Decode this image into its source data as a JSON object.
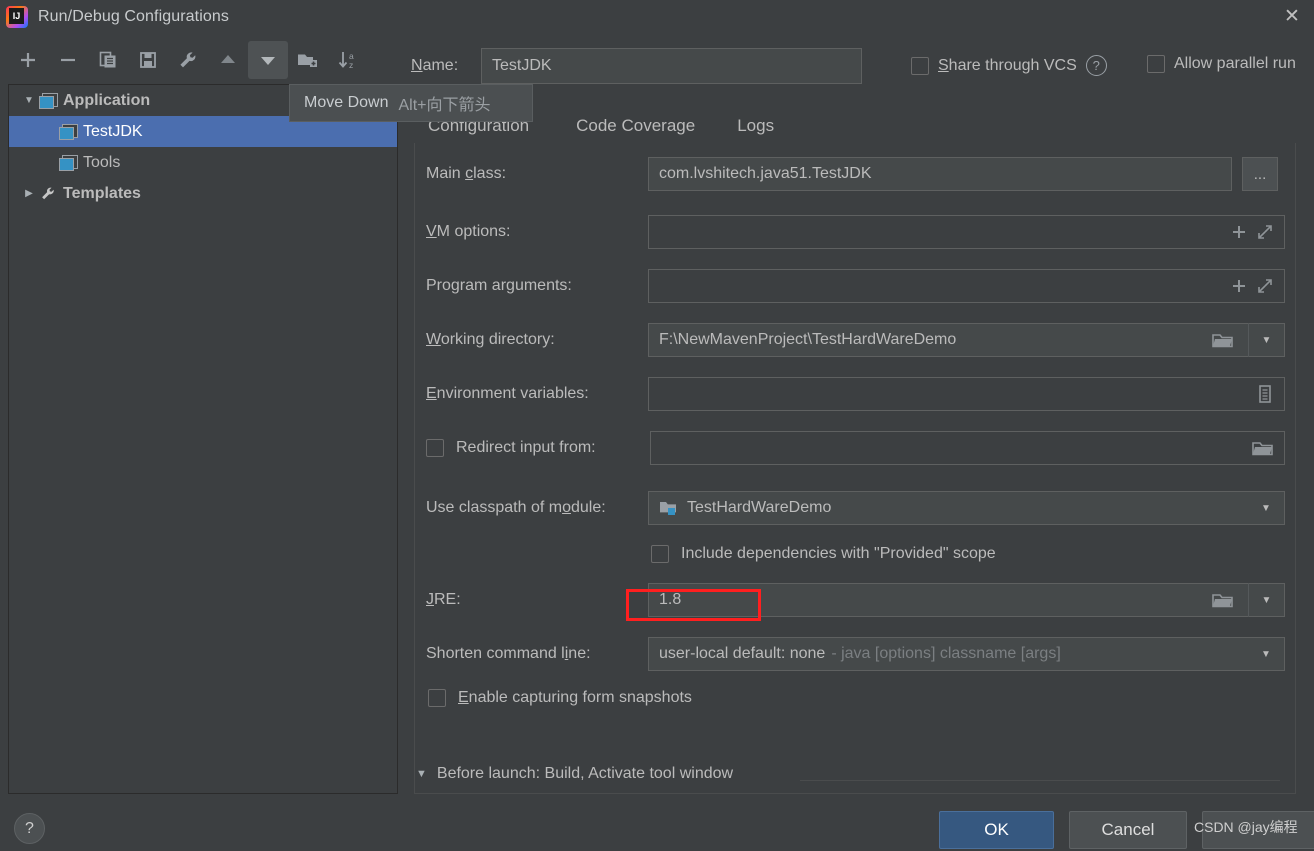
{
  "window": {
    "title": "Run/Debug Configurations",
    "app_icon": "intellij-idea-icon",
    "close_icon": "close-icon"
  },
  "toolbar": {
    "buttons": [
      {
        "name": "add-configuration-button",
        "icon": "plus-icon",
        "label": "+"
      },
      {
        "name": "remove-configuration-button",
        "icon": "minus-icon",
        "label": "−"
      },
      {
        "name": "copy-configuration-button",
        "icon": "copy-icon",
        "label": "Copy"
      },
      {
        "name": "save-configuration-button",
        "icon": "save-icon",
        "label": "Save"
      },
      {
        "name": "edit-templates-button",
        "icon": "wrench-icon",
        "label": "Edit Templates"
      },
      {
        "name": "move-up-button",
        "icon": "arrow-up-icon",
        "label": "Move Up"
      },
      {
        "name": "move-down-button",
        "icon": "arrow-down-icon",
        "label": "Move Down"
      },
      {
        "name": "new-folder-button",
        "icon": "folder-add-icon",
        "label": "New Folder"
      },
      {
        "name": "sort-alphabetically-button",
        "icon": "sort-az-icon",
        "label": "Sort Configurations"
      }
    ]
  },
  "tooltip": {
    "label": "Move Down",
    "shortcut": "Alt+向下箭头"
  },
  "name_field": {
    "label": "Name:",
    "label_mnemonic": "N",
    "label_rest": "ame:",
    "value": "TestJDK",
    "placeholder": ""
  },
  "header_options": {
    "share_vcs": {
      "label": "Share through VCS",
      "mnemonic": "S",
      "rest": "hare through VCS",
      "checked": false
    },
    "help_icon": "help-icon",
    "allow_parallel": {
      "label": "Allow parallel run",
      "checked": false
    }
  },
  "tree": {
    "items": [
      {
        "label": "Application",
        "icon": "application-icon",
        "twisty": "▼",
        "level": 0,
        "bold": true,
        "selected": false
      },
      {
        "label": "TestJDK",
        "icon": "application-icon",
        "twisty": "",
        "level": 1,
        "bold": false,
        "selected": true
      },
      {
        "label": "Tools",
        "icon": "application-icon",
        "twisty": "",
        "level": 1,
        "bold": false,
        "selected": false
      },
      {
        "label": "Templates",
        "icon": "wrench-icon",
        "twisty": "▶",
        "level": 0,
        "bold": true,
        "selected": false
      }
    ]
  },
  "tabs": {
    "items": [
      {
        "label": "Configuration",
        "active": true
      },
      {
        "label": "Code Coverage",
        "active": false
      },
      {
        "label": "Logs",
        "active": false
      }
    ]
  },
  "form": {
    "main_class": {
      "label_pre": "Main ",
      "label_mn": "c",
      "label_post": "lass:",
      "label": "Main class:",
      "value": "com.lvshitech.java51.TestJDK",
      "browse_label": "..."
    },
    "vm_options": {
      "label_pre": "",
      "label_mn": "V",
      "label_post": "M options:",
      "label": "VM options:",
      "value": "",
      "icons": [
        "plus-icon",
        "expand-icon"
      ]
    },
    "program_arguments": {
      "label_pre": "Program ar",
      "label_mn": "g",
      "label_post": "uments:",
      "label": "Program arguments:",
      "value": "",
      "icons": [
        "plus-icon",
        "expand-icon"
      ]
    },
    "working_directory": {
      "label_pre": "",
      "label_mn": "W",
      "label_post": "orking directory:",
      "label": "Working directory:",
      "value": "F:\\NewMavenProject\\TestHardWareDemo",
      "icons": [
        "folder-icon",
        "chevron-down-icon"
      ]
    },
    "environment_variables": {
      "label_pre": "",
      "label_mn": "E",
      "label_post": "nvironment variables:",
      "label": "Environment variables:",
      "value": "",
      "icons": [
        "list-edit-icon"
      ]
    },
    "redirect_input": {
      "label": "Redirect input from:",
      "checked": false,
      "value": "",
      "icons": [
        "folder-icon"
      ]
    },
    "use_classpath_of_module": {
      "label_pre": "Use classpath of m",
      "label_mn": "o",
      "label_post": "dule:",
      "label": "Use classpath of module:",
      "value": "TestHardWareDemo",
      "value_icon": "module-folder-icon",
      "icons": [
        "chevron-down-icon"
      ]
    },
    "include_provided": {
      "label": "Include dependencies with \"Provided\" scope",
      "checked": false
    },
    "jre": {
      "label_pre": "",
      "label_mn": "J",
      "label_post": "RE:",
      "label": "JRE:",
      "value": "1.8",
      "icons": [
        "folder-icon",
        "chevron-down-icon"
      ],
      "highlight_color": "#ff1f1f"
    },
    "shorten_command_line": {
      "label_pre": "Shorten command l",
      "label_mn": "i",
      "label_post": "ne:",
      "label": "Shorten command line:",
      "value": "user-local default: none",
      "value_hint": "- java [options] classname [args]",
      "icons": [
        "chevron-down-icon"
      ]
    },
    "enable_capturing": {
      "label_pre": "",
      "label_mn": "E",
      "label_post": "nable capturing form snapshots",
      "label": "Enable capturing form snapshots",
      "checked": false
    }
  },
  "before_launch": {
    "twisty": "▼",
    "label": "Before launch: Build, Activate tool window"
  },
  "footer": {
    "help_label": "?",
    "ok_label": "OK",
    "cancel_label": "Cancel",
    "apply_label": "",
    "watermark": "CSDN @jay编程"
  },
  "colors": {
    "background": "#3c3f41",
    "selection": "#4b6eaf",
    "accent": "#4a88c7",
    "primary_button": "#365880",
    "highlight": "#ff1f1f"
  }
}
